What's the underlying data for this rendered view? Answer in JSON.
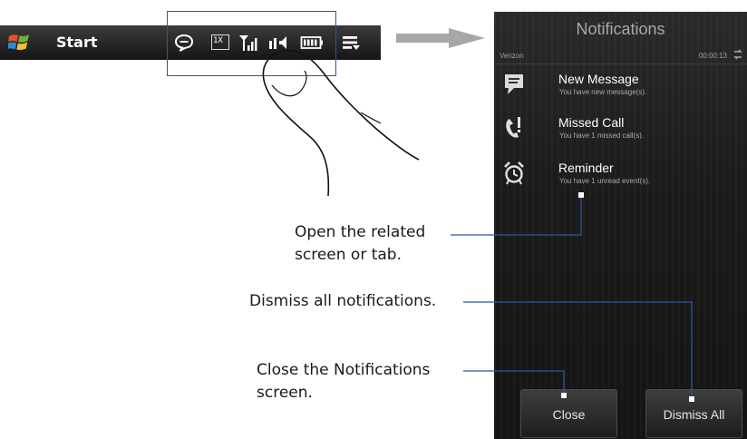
{
  "taskbar": {
    "start_label": "Start",
    "status_icons": [
      "windows-logo-icon",
      "notification-bubble-icon",
      "data-1x-icon",
      "signal-icon",
      "speaker-icon",
      "battery-icon",
      "menu-icon"
    ],
    "indicator_text": "1X"
  },
  "phone": {
    "title": "Notifications",
    "carrier": "Verizon",
    "time": "00:00:13",
    "notifications": [
      {
        "icon": "message-icon",
        "title": "New Message",
        "subtitle": "You have new message(s)."
      },
      {
        "icon": "missed-call-icon",
        "title": "Missed Call",
        "subtitle": "You have 1 missed call(s)."
      },
      {
        "icon": "alarm-clock-icon",
        "title": "Reminder",
        "subtitle": "You have 1 unread event(s)."
      }
    ],
    "buttons": {
      "close": "Close",
      "dismiss_all": "Dismiss All"
    }
  },
  "callouts": {
    "open_line1": "Open the related",
    "open_line2": "screen or tab.",
    "dismiss": "Dismiss all notifications.",
    "close_line1": "Close the Notifications",
    "close_line2": "screen."
  },
  "colors": {
    "callout_line": "#2c55a0",
    "phone_bg": "#1b1b1b"
  }
}
